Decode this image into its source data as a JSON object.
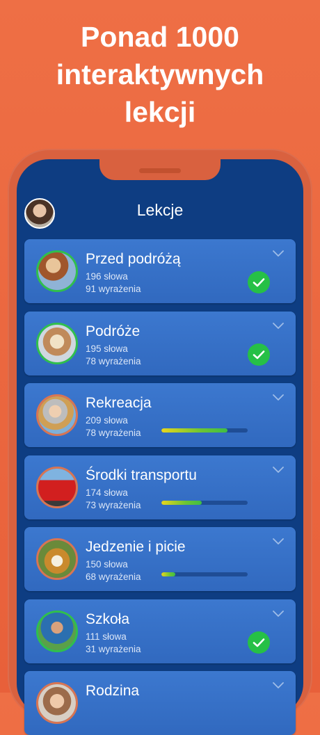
{
  "headline": {
    "line1": "Ponad 1000",
    "line2": "interaktywnych",
    "line3": "lekcji"
  },
  "app": {
    "title": "Lekcje",
    "avatar_icon": "user-avatar"
  },
  "lessons": [
    {
      "title": "Przed podróżą",
      "words": "196 słowa",
      "phrases": "91 wyrażenia",
      "completed": true,
      "progress": null,
      "image_icon": "traveler-with-map-icon"
    },
    {
      "title": "Podróże",
      "words": "195 słowa",
      "phrases": "78 wyrażenia",
      "completed": true,
      "progress": null,
      "image_icon": "couple-with-map-icon"
    },
    {
      "title": "Rekreacja",
      "words": "209 słowa",
      "phrases": "78 wyrażenia",
      "completed": false,
      "progress": 0.77,
      "image_icon": "couple-selfie-icon"
    },
    {
      "title": "Środki transportu",
      "words": "174 słowa",
      "phrases": "73 wyrażenia",
      "completed": false,
      "progress": 0.47,
      "image_icon": "double-decker-bus-icon"
    },
    {
      "title": "Jedzenie i picie",
      "words": "150 słowa",
      "phrases": "68 wyrażenia",
      "completed": false,
      "progress": 0.16,
      "image_icon": "wine-and-food-icon"
    },
    {
      "title": "Szkoła",
      "words": "111 słowa",
      "phrases": "31 wyrażenia",
      "completed": true,
      "progress": null,
      "image_icon": "teacher-with-apple-icon"
    },
    {
      "title": "Rodzina",
      "words": "",
      "phrases": "",
      "completed": false,
      "progress": null,
      "image_icon": "family-icon"
    }
  ],
  "colors": {
    "background": "#ee6f45",
    "screen": "#0e3d82",
    "card": "#3a74cb",
    "check": "#26c046",
    "progress_start": "#e8d61e",
    "progress_end": "#3fbe46"
  }
}
